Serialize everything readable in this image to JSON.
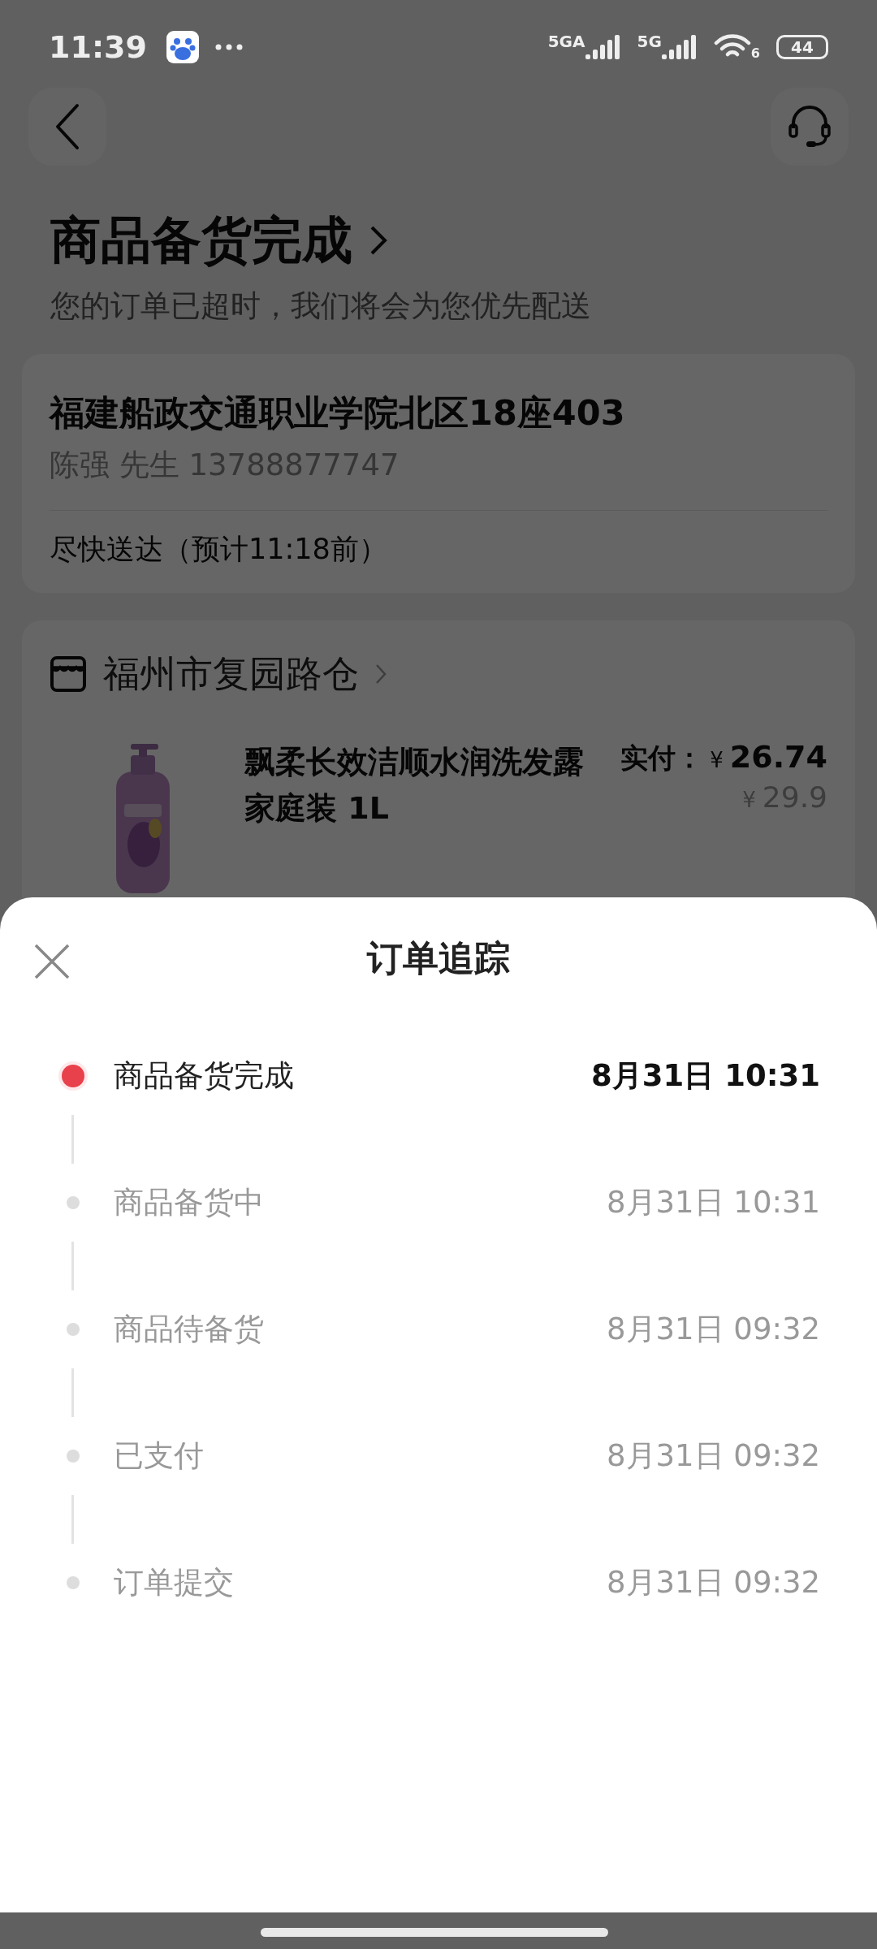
{
  "status_bar": {
    "time": "11:39",
    "network_1": "5GA",
    "network_2": "5G",
    "wifi_badge": "6",
    "battery": "44"
  },
  "header": {
    "title": "商品备货完成",
    "subtitle": "您的订单已超时，我们将会为您优先配送"
  },
  "address_card": {
    "address": "福建船政交通职业学院北区18座403",
    "contact": "陈强 先生 13788877747",
    "delivery": "尽快送达（预计11:18前）"
  },
  "store_card": {
    "store": "福州市复园路仓",
    "product": {
      "kind": "picture",
      "name": "飘柔长效洁顺水润洗发露家庭装 1L",
      "paid_label": "实付：",
      "paid_currency": "¥",
      "paid_amount": "26.74",
      "original_currency": "¥",
      "original_amount": "29.9"
    }
  },
  "tracking_sheet": {
    "title": "订单追踪",
    "events": [
      {
        "label": "商品备货完成",
        "time": "8月31日 10:31",
        "current": true
      },
      {
        "label": "商品备货中",
        "time": "8月31日 10:31",
        "current": false
      },
      {
        "label": "商品待备货",
        "time": "8月31日 09:32",
        "current": false
      },
      {
        "label": "已支付",
        "time": "8月31日 09:32",
        "current": false
      },
      {
        "label": "订单提交",
        "time": "8月31日 09:32",
        "current": false
      }
    ]
  }
}
